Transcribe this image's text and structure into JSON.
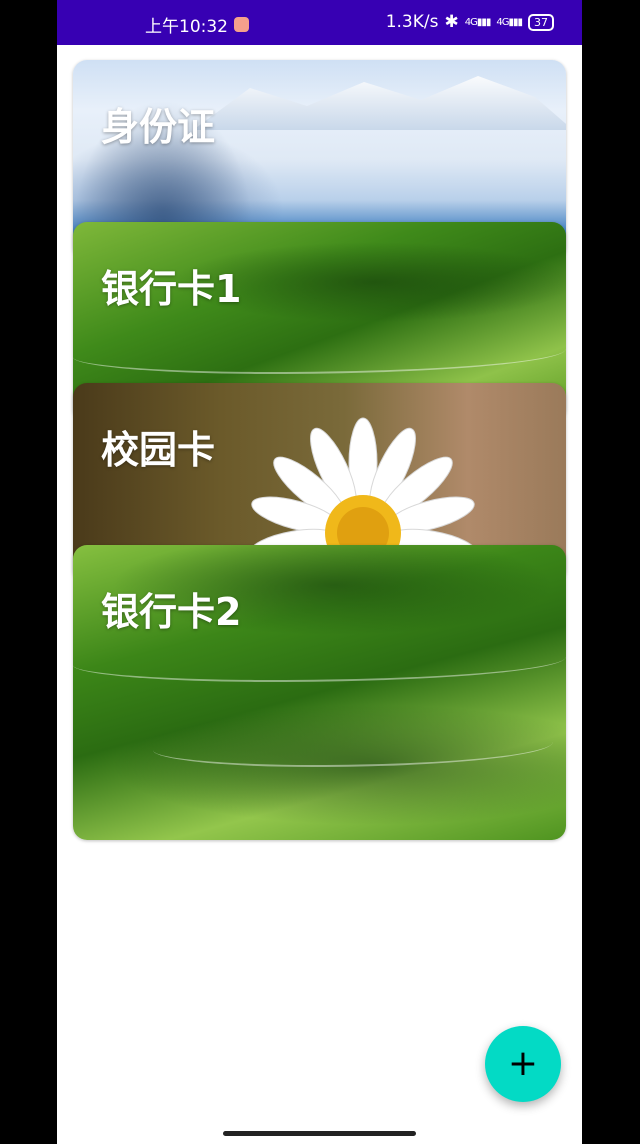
{
  "status_bar": {
    "time": "上午10:32",
    "net_speed": "1.3K/s",
    "signal1": "4G",
    "signal2": "4G",
    "battery": "37"
  },
  "cards": [
    {
      "title": "身份证"
    },
    {
      "title": "银行卡1"
    },
    {
      "title": "校园卡"
    },
    {
      "title": "银行卡2"
    }
  ],
  "fab": {
    "label": "+"
  },
  "colors": {
    "status_bar": "#3700b3",
    "fab": "#03dac5",
    "background": "#ffffff"
  }
}
